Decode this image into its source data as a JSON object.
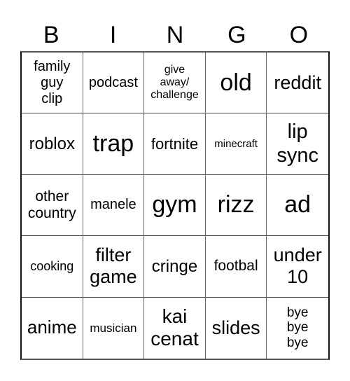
{
  "header": [
    "B",
    "I",
    "N",
    "G",
    "O"
  ],
  "cells": [
    {
      "text": "family\nguy\nclip",
      "size": 20
    },
    {
      "text": "podcast",
      "size": 20
    },
    {
      "text": "give\naway/\nchallenge",
      "size": 16
    },
    {
      "text": "old",
      "size": 34
    },
    {
      "text": "reddit",
      "size": 27
    },
    {
      "text": "roblox",
      "size": 24
    },
    {
      "text": "trap",
      "size": 34
    },
    {
      "text": "fortnite",
      "size": 22
    },
    {
      "text": "minecraft",
      "size": 15
    },
    {
      "text": "lip\nsync",
      "size": 29
    },
    {
      "text": "other\ncountry",
      "size": 21
    },
    {
      "text": "manele",
      "size": 20
    },
    {
      "text": "gym",
      "size": 34
    },
    {
      "text": "rizz",
      "size": 34
    },
    {
      "text": "ad",
      "size": 34
    },
    {
      "text": "cooking",
      "size": 18
    },
    {
      "text": "filter\ngame",
      "size": 27
    },
    {
      "text": "cringe",
      "size": 24
    },
    {
      "text": "footbal",
      "size": 21
    },
    {
      "text": "under\n10",
      "size": 27
    },
    {
      "text": "anime",
      "size": 26
    },
    {
      "text": "musician",
      "size": 17
    },
    {
      "text": "kai\ncenat",
      "size": 28
    },
    {
      "text": "slides",
      "size": 27
    },
    {
      "text": "bye\nbye\nbye",
      "size": 19
    }
  ]
}
